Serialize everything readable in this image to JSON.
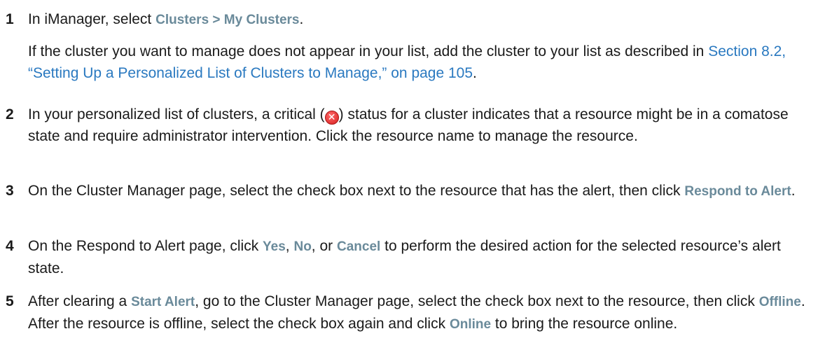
{
  "steps": [
    {
      "number": "1",
      "p1": {
        "pre": "In iManager, select ",
        "ui": "Clusters > My Clusters",
        "post": "."
      },
      "p2": {
        "pre": "If the cluster you want to manage does not appear in your list, add the cluster to your list as described in ",
        "link": "Section 8.2, “Setting Up a Personalized List of Clusters to Manage,” on page 105",
        "post": "."
      }
    },
    {
      "number": "2",
      "pre": "In your personalized list of clusters, a critical (",
      "icon": "critical-status-icon",
      "icon_glyph": "✕",
      "post": ") status for a cluster indicates that a resource might be in a comatose state and require administrator intervention. Click the resource name to manage the resource."
    },
    {
      "number": "3",
      "pre": "On the Cluster Manager page, select the check box next to the resource that has the alert, then click ",
      "ui": "Respond to Alert",
      "post": "."
    },
    {
      "number": "4",
      "pre": "On the Respond to Alert page, click ",
      "yes": "Yes",
      "sep1": ", ",
      "no": "No",
      "sep2": ", or ",
      "cancel": "Cancel",
      "post": " to perform the desired action for the selected resource’s alert state."
    },
    {
      "number": "5",
      "pre": "After clearing a ",
      "ui1": "Start Alert",
      "mid1": ", go to the Cluster Manager page, select the check box next to the resource, then click ",
      "ui2": "Offline",
      "mid2": ". After the resource is offline, select the check box again and click ",
      "ui3": "Online",
      "post": " to bring the resource online."
    }
  ]
}
